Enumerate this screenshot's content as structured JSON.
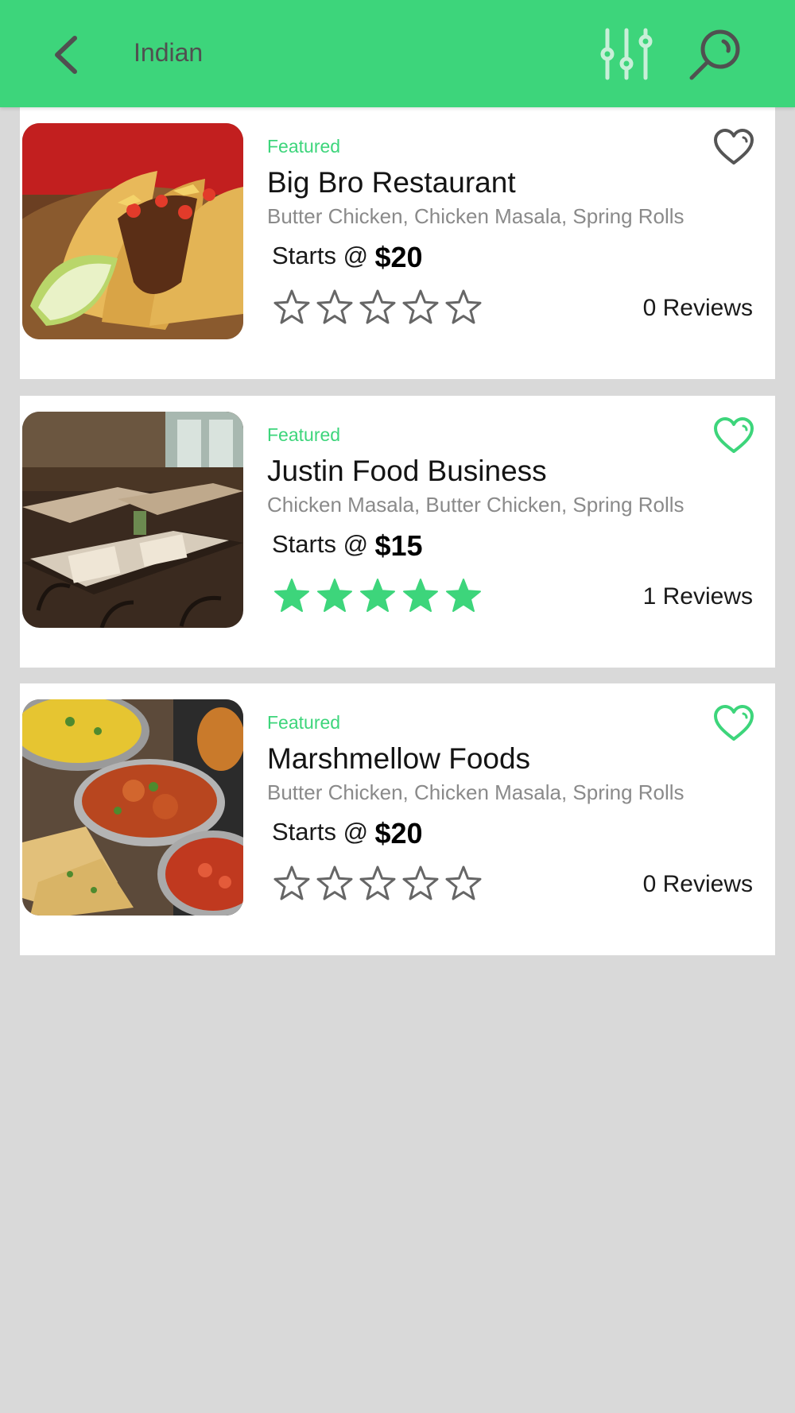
{
  "header": {
    "title": "Indian",
    "bg_color": "#3dd57b",
    "back_icon": "chevron-left-icon",
    "filter_icon": "sliders-icon",
    "search_icon": "search-icon"
  },
  "accent_color": "#3dd57b",
  "restaurants": [
    {
      "badge": "Featured",
      "name": "Big Bro Restaurant",
      "dishes": "Butter Chicken, Chicken Masala, Spring Rolls",
      "price_prefix": "Starts @",
      "price": "$20",
      "rating": 0,
      "max_rating": 5,
      "reviews": "0 Reviews",
      "favorited": false,
      "image": "tacos-photo"
    },
    {
      "badge": "Featured",
      "name": "Justin Food Business",
      "dishes": "Chicken Masala, Butter Chicken, Spring Rolls",
      "price_prefix": "Starts @",
      "price": "$15",
      "rating": 5,
      "max_rating": 5,
      "reviews": "1 Reviews",
      "favorited": true,
      "image": "restaurant-interior-photo"
    },
    {
      "badge": "Featured",
      "name": "Marshmellow Foods",
      "dishes": "Butter Chicken, Chicken Masala, Spring Rolls",
      "price_prefix": "Starts @",
      "price": "$20",
      "rating": 0,
      "max_rating": 5,
      "reviews": "0 Reviews",
      "favorited": true,
      "image": "indian-food-photo"
    }
  ]
}
